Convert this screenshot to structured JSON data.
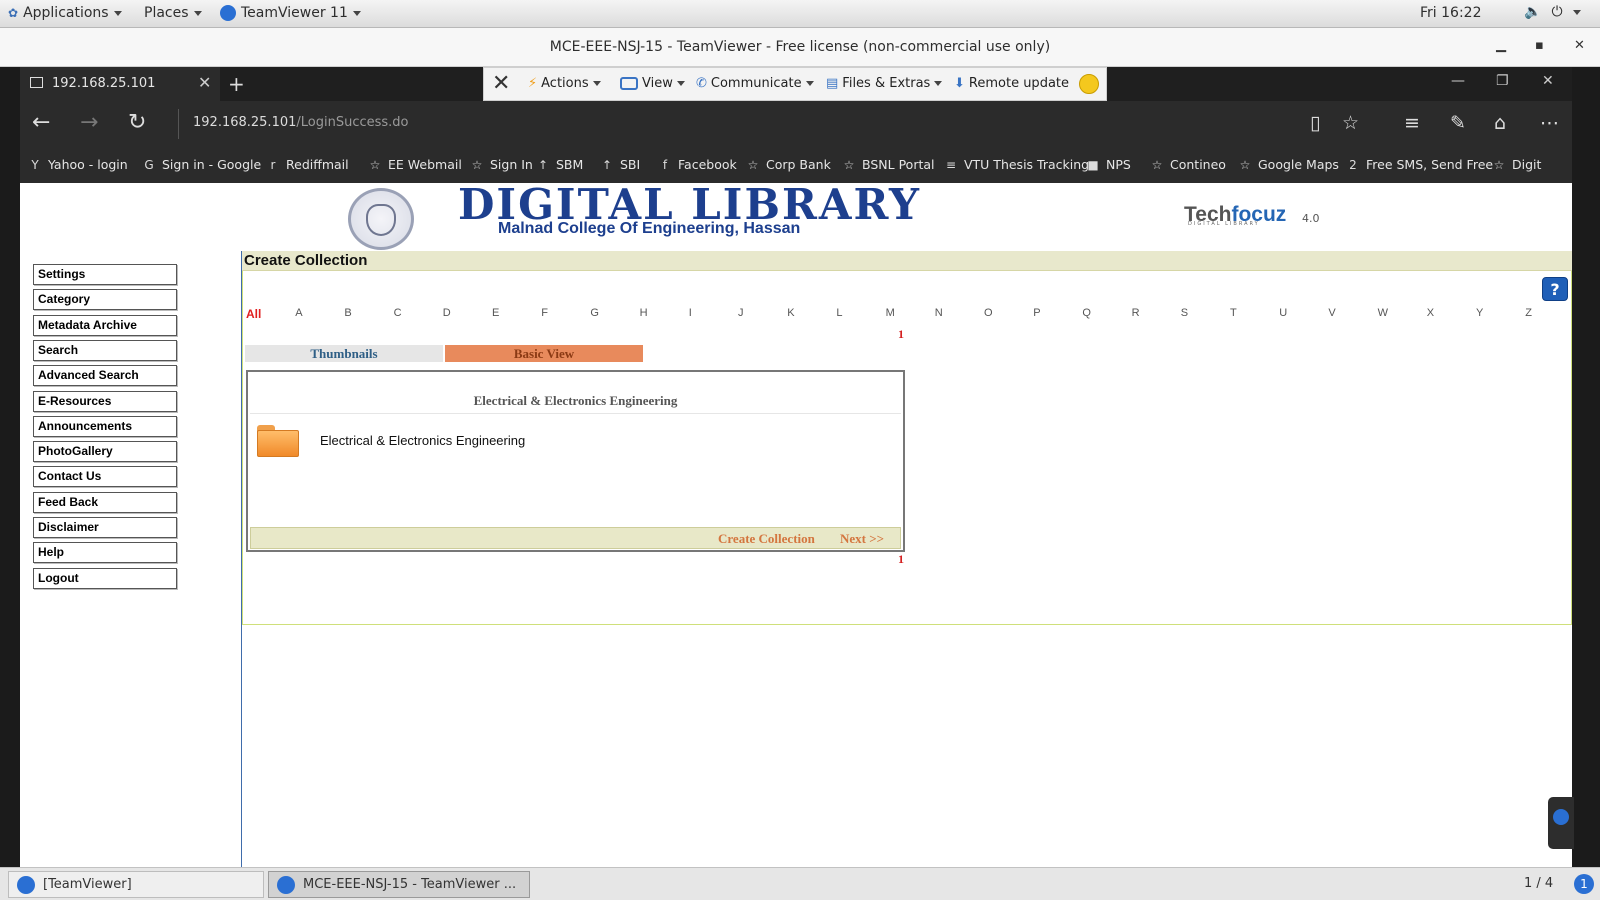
{
  "topbar": {
    "applications_label": "Applications",
    "places_label": "Places",
    "teamviewer_label": "TeamViewer 11",
    "clock": "Fri 16:22"
  },
  "teamviewer_window": {
    "title": "MCE-EEE-NSJ-15 - TeamViewer - Free license (non-commercial use only)"
  },
  "tv_toolbar": {
    "actions": "Actions",
    "view": "View",
    "communicate": "Communicate",
    "files_extras": "Files & Extras",
    "remote_update": "Remote update"
  },
  "browser": {
    "tab_title": "192.168.25.101",
    "url_host": "192.168.25.101",
    "url_path": "/LoginSuccess.do",
    "favorites": [
      {
        "label": "Yahoo - login",
        "icon": "Y"
      },
      {
        "label": "Sign in - Google",
        "icon": "G"
      },
      {
        "label": "Rediffmail",
        "icon": "r"
      },
      {
        "label": "EE Webmail",
        "icon": "☆"
      },
      {
        "label": "Sign In",
        "icon": "☆"
      },
      {
        "label": "SBM",
        "icon": "↑"
      },
      {
        "label": "SBI",
        "icon": "↑"
      },
      {
        "label": "Facebook",
        "icon": "f"
      },
      {
        "label": "Corp Bank",
        "icon": "☆"
      },
      {
        "label": "BSNL Portal",
        "icon": "☆"
      },
      {
        "label": "VTU Thesis Tracking",
        "icon": "≡"
      },
      {
        "label": "NPS",
        "icon": "■"
      },
      {
        "label": "Contineo",
        "icon": "☆"
      },
      {
        "label": "Google Maps",
        "icon": "☆"
      },
      {
        "label": "Free SMS, Send Free",
        "icon": "2"
      },
      {
        "label": "Digit",
        "icon": "☆"
      }
    ]
  },
  "site": {
    "title": "DIGITAL LIBRARY",
    "subtitle": "Malnad College Of Engineering, Hassan",
    "brand_a": "Tech",
    "brand_b": "focuz",
    "brand_sub": "DIGITAL LIBRARY",
    "brand_version": "4.0"
  },
  "sidebar": {
    "items": [
      "Settings",
      "Category",
      "Metadata Archive",
      "Search",
      "Advanced Search",
      "E-Resources",
      "Announcements",
      "PhotoGallery",
      "Contact Us",
      "Feed Back",
      "Disclaimer",
      "Help",
      "Logout"
    ]
  },
  "main": {
    "heading": "Create Collection",
    "help_glyph": "?",
    "alphabet": [
      "All",
      "A",
      "B",
      "C",
      "D",
      "E",
      "F",
      "G",
      "H",
      "I",
      "J",
      "K",
      "L",
      "M",
      "N",
      "O",
      "P",
      "Q",
      "R",
      "S",
      "T",
      "U",
      "V",
      "W",
      "X",
      "Y",
      "Z"
    ],
    "page_number_top": "1",
    "page_number_bottom": "1",
    "view_tabs": {
      "thumbnails": "Thumbnails",
      "basic_view": "Basic View"
    },
    "box_title": "Electrical & Electronics Engineering",
    "item_label": "Electrical & Electronics Engineering",
    "create_collection": "Create Collection",
    "next": "Next >>"
  },
  "taskbar": {
    "task1": "[TeamViewer]",
    "task2": "MCE-EEE-NSJ-15 - TeamViewer ...",
    "pager": "1 / 4",
    "notif_count": "1"
  }
}
